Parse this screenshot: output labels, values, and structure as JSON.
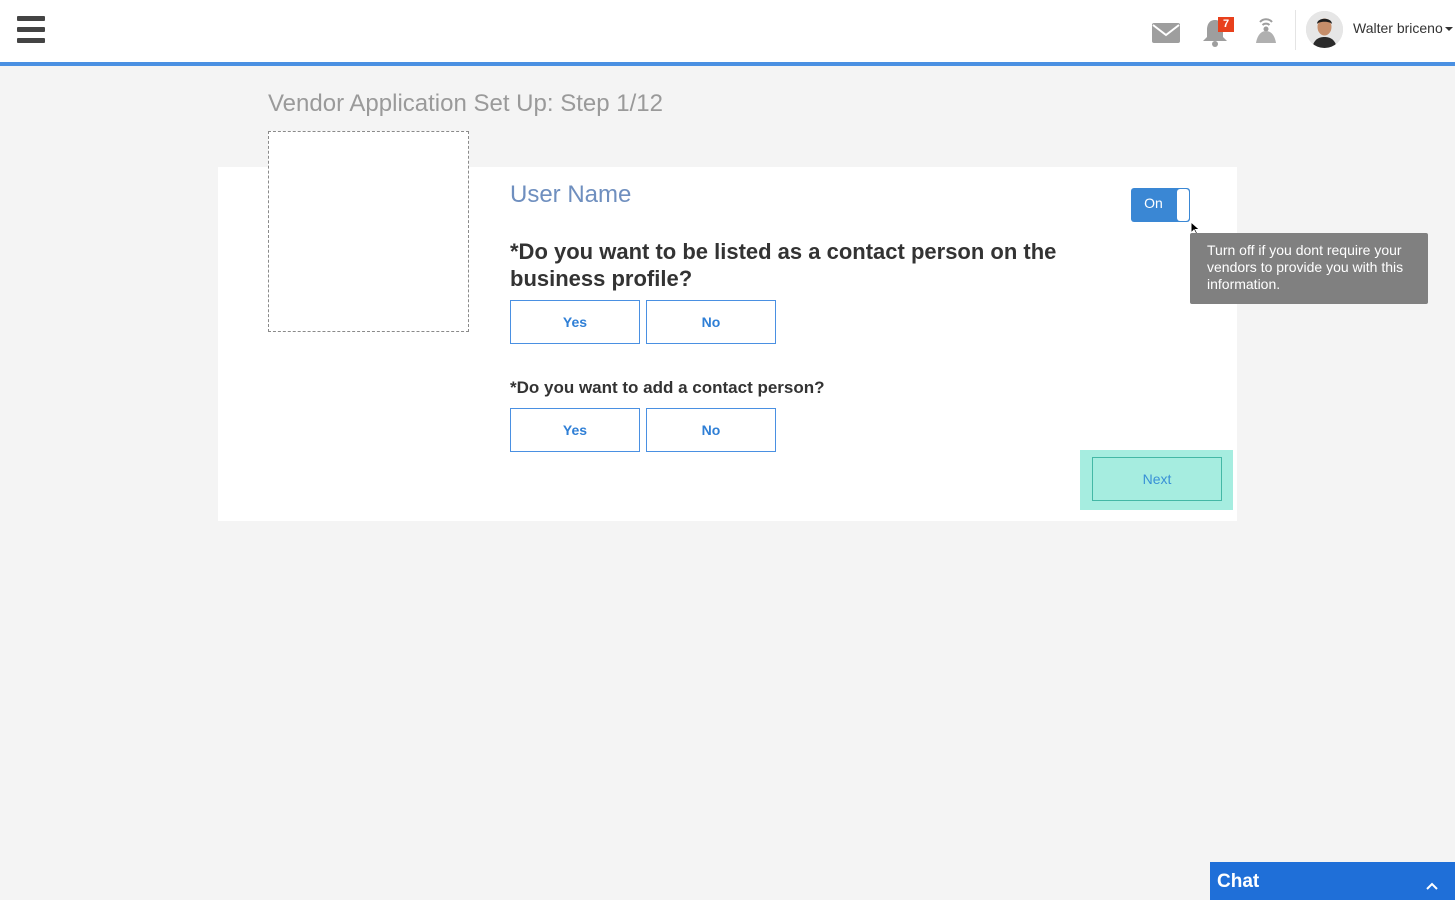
{
  "header": {
    "notifications_count": "7",
    "user_name": "Walter briceno"
  },
  "page": {
    "title": "Vendor Application Set Up: Step 1/12"
  },
  "card": {
    "field_title": "User Name",
    "toggle_label": "On",
    "toggle_state": "on",
    "tooltip": "Turn off if you dont require your vendors to provide you with this information.",
    "question_1": "*Do you want to be listed as a contact person on the business profile?",
    "question_1_yes": "Yes",
    "question_1_no": "No",
    "question_2": "*Do you want to add a contact person?",
    "question_2_yes": "Yes",
    "question_2_no": "No",
    "next_label": "Next"
  },
  "chat": {
    "label": "Chat"
  },
  "colors": {
    "accent": "#4a90e2",
    "toggle": "#3a87d4",
    "next_highlight": "#a6ede0",
    "badge": "#e8401c",
    "chat": "#1f6fd8"
  },
  "icons": {
    "menu": "hamburger-menu-icon",
    "mail": "envelope-icon",
    "notifications": "bell-icon",
    "broadcast": "broadcast-icon",
    "chat_toggle": "chevron-up-icon"
  }
}
